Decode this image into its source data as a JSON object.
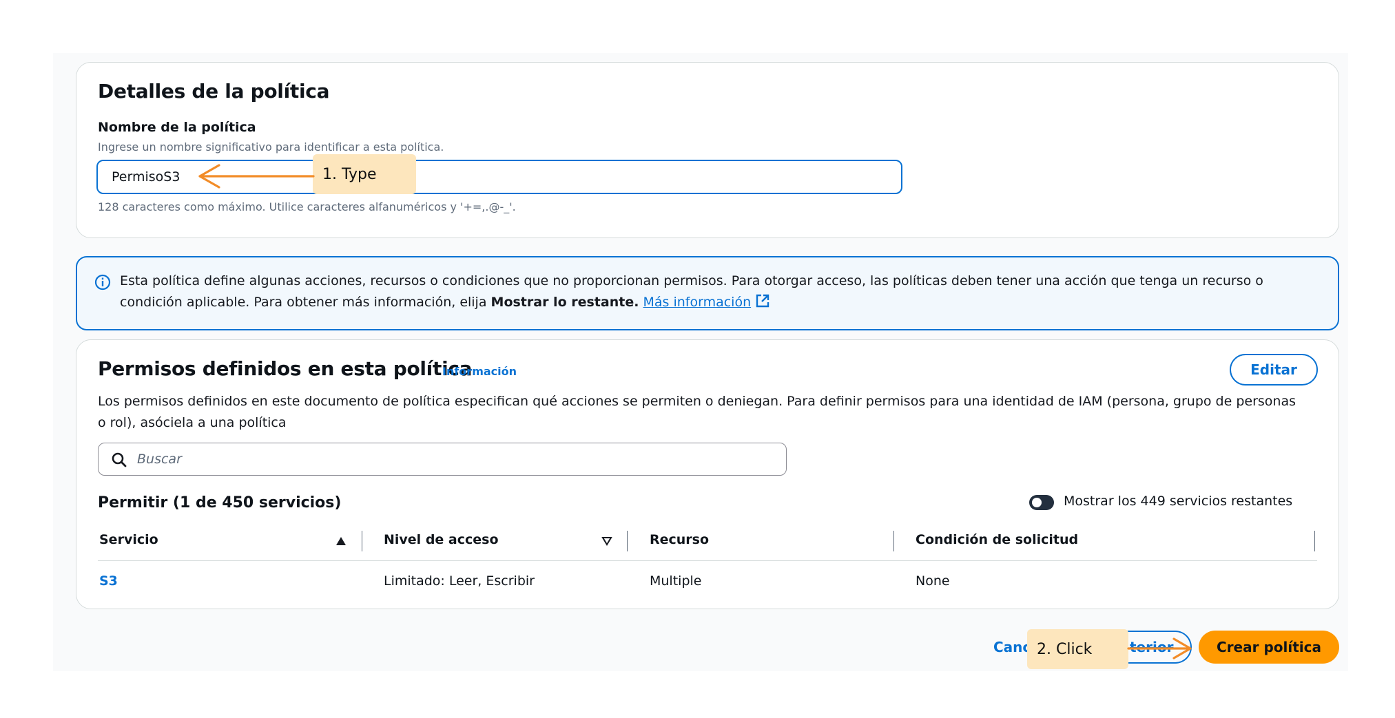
{
  "details": {
    "title": "Detalles de la política",
    "name_label": "Nombre de la política",
    "name_desc": "Ingrese un nombre significativo para identificar a esta política.",
    "name_value": "PermisoS3",
    "name_constraint": "128 caracteres como máximo. Utilice caracteres alfanuméricos y '+=,.@-_'."
  },
  "alert": {
    "text_line1": "Esta política define algunas acciones, recursos o condiciones que no proporcionan permisos. Para otorgar acceso, las políticas deben tener una acción que tenga un recurso o",
    "text_line2_prefix": "condición aplicable. Para obtener más información, elija ",
    "text_bold": "Mostrar lo restante.",
    "link": "Más información"
  },
  "permissions": {
    "title": "Permisos definidos en esta política",
    "info_link": "Información",
    "edit_button": "Editar",
    "description_line1": "Los permisos definidos en este documento de política especifican qué acciones se permiten o deniegan. Para definir permisos para una identidad de IAM (persona, grupo de personas",
    "description_line2": "o rol), asóciela a una política",
    "search_placeholder": "Buscar",
    "allow_heading": "Permitir (1 de 450 servicios)",
    "toggle_label": "Mostrar los 449 servicios restantes",
    "columns": [
      "Servicio",
      "Nivel de acceso",
      "Recurso",
      "Condición de solicitud"
    ],
    "rows": [
      {
        "service": "S3",
        "access_level": "Limitado: Leer, Escribir",
        "resource": "Multiple",
        "condition": "None"
      }
    ]
  },
  "footer": {
    "cancel_partial": "Canc",
    "previous_partial": "terior",
    "create_button": "Crear política"
  },
  "annotations": {
    "step1": "1. Type",
    "step2": "2. Click",
    "arrow_color": "#f28c28",
    "callout_color": "#fde6bd"
  },
  "colors": {
    "accent": "#0972d3",
    "primary_button": "#ff9900"
  }
}
